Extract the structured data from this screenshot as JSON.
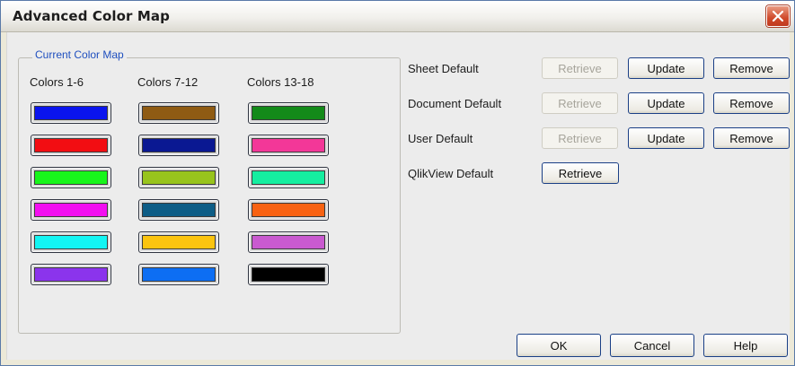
{
  "window": {
    "title": "Advanced Color Map"
  },
  "colormap": {
    "legend": "Current Color Map",
    "columns": [
      {
        "header": "Colors 1-6",
        "colors": [
          "#0a14ee",
          "#f20d12",
          "#18f51b",
          "#f20ff0",
          "#13f5f3",
          "#8b34ec"
        ]
      },
      {
        "header": "Colors 7-12",
        "colors": [
          "#8f5b13",
          "#0a1892",
          "#98c41c",
          "#0d5d86",
          "#fbc40f",
          "#0d6ef3"
        ]
      },
      {
        "header": "Colors 13-18",
        "colors": [
          "#138a19",
          "#f33798",
          "#15eea0",
          "#f86212",
          "#c95ad0",
          "#000000"
        ]
      }
    ]
  },
  "defaults": {
    "rows": [
      {
        "label": "Sheet Default",
        "retrieve": "Retrieve",
        "update": "Update",
        "remove": "Remove"
      },
      {
        "label": "Document Default",
        "retrieve": "Retrieve",
        "update": "Update",
        "remove": "Remove"
      },
      {
        "label": "User Default",
        "retrieve": "Retrieve",
        "update": "Update",
        "remove": "Remove"
      },
      {
        "label": "QlikView Default",
        "retrieve": "Retrieve"
      }
    ]
  },
  "footer": {
    "ok": "OK",
    "cancel": "Cancel",
    "help": "Help"
  },
  "theme": {
    "title_color": "#1d1d1d",
    "accent": "#1f4fbf",
    "close_red": "#d04a2b"
  }
}
